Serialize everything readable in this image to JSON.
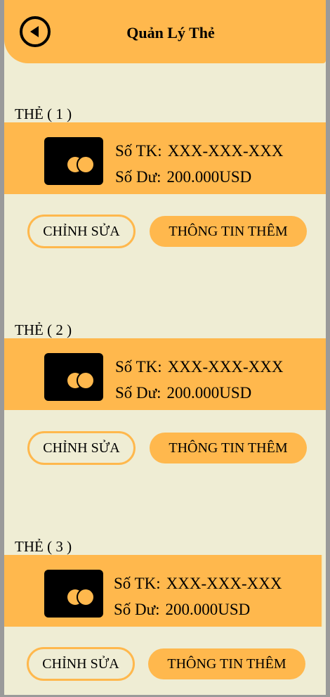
{
  "header": {
    "title": "Quản Lý Thẻ",
    "back_icon": "back-arrow-circle-icon"
  },
  "colors": {
    "accent": "#ffb84d",
    "background": "#efedd4",
    "text": "#000000"
  },
  "cards": [
    {
      "heading": "THẺ ( 1 )",
      "account_label": "Số TK:",
      "account_value": "XXX-XXX-XXX",
      "balance_label": "Số Dư:",
      "balance_value": "200.000USD",
      "edit_label": "CHỈNH SỬA",
      "more_label": "THÔNG TIN THÊM"
    },
    {
      "heading": "THẺ ( 2 )",
      "account_label": "Số TK:",
      "account_value": "XXX-XXX-XXX",
      "balance_label": "Số Dư:",
      "balance_value": "200.000USD",
      "edit_label": "CHỈNH SỬA",
      "more_label": "THÔNG TIN THÊM"
    },
    {
      "heading": "THẺ ( 3 )",
      "account_label": "Số TK:",
      "account_value": "XXX-XXX-XXX",
      "balance_label": "Số Dư:",
      "balance_value": "200.000USD",
      "edit_label": "CHỈNH SỬA",
      "more_label": "THÔNG TIN THÊM"
    }
  ]
}
